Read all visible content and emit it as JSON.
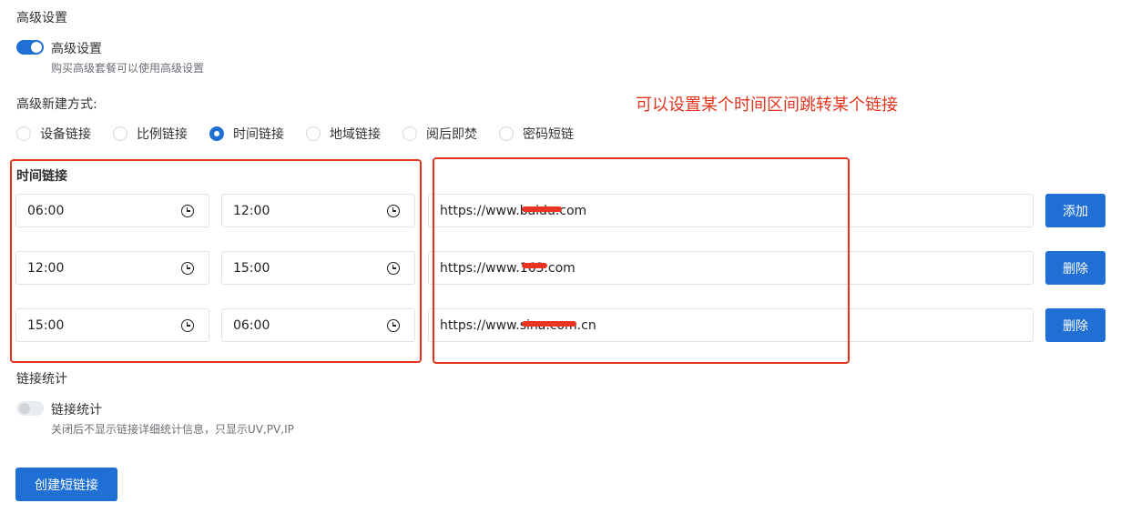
{
  "advanced": {
    "section_title": "高级设置",
    "toggle_label": "高级设置",
    "toggle_on": true,
    "hint": "购买高级套餐可以使用高级设置"
  },
  "mode": {
    "label": "高级新建方式:",
    "options": [
      {
        "label": "设备链接",
        "checked": false
      },
      {
        "label": "比例链接",
        "checked": false
      },
      {
        "label": "时间链接",
        "checked": true
      },
      {
        "label": "地域链接",
        "checked": false
      },
      {
        "label": "阅后即焚",
        "checked": false
      },
      {
        "label": "密码短链",
        "checked": false
      }
    ]
  },
  "annotation": "可以设置某个时间区间跳转某个链接",
  "time_link": {
    "title": "时间链接",
    "rows": [
      {
        "start": "06:00",
        "end": "12:00",
        "url": "https://www.baidu.com",
        "button": "添加"
      },
      {
        "start": "12:00",
        "end": "15:00",
        "url": "https://www.163.com",
        "button": "删除"
      },
      {
        "start": "15:00",
        "end": "06:00",
        "url": "https://www.sina.com.cn",
        "button": "删除"
      }
    ]
  },
  "stats": {
    "section_title": "链接统计",
    "toggle_label": "链接统计",
    "toggle_on": false,
    "hint": "关闭后不显示链接详细统计信息，只显示UV,PV,IP"
  },
  "create_button": "创建短链接",
  "colors": {
    "primary": "#1f6fd4",
    "annotation": "#e3341e"
  },
  "icons": {
    "time_picker": "clock-icon"
  }
}
